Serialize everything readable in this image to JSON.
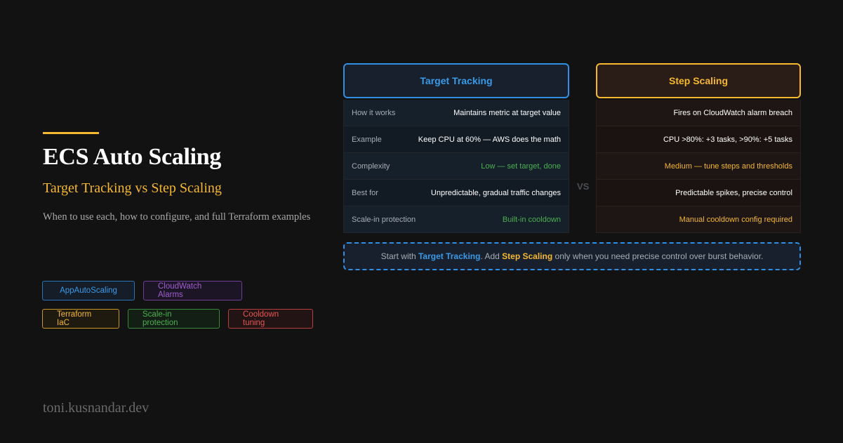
{
  "hero": {
    "title": "ECS Auto Scaling",
    "subtitle": "Target Tracking vs Step Scaling",
    "description": "When to use each, how to configure, and full Terraform examples"
  },
  "tags": [
    {
      "label": "AppAutoScaling",
      "color": "#3b9ae8"
    },
    {
      "label": "CloudWatch Alarms",
      "color": "#a05ccf"
    },
    {
      "label": "Terraform IaC",
      "color": "#f5b82e"
    },
    {
      "label": "Scale-in protection",
      "color": "#4cb050"
    },
    {
      "label": "Cooldown tuning",
      "color": "#e85454"
    }
  ],
  "comparison": {
    "left": {
      "title": "Target Tracking",
      "rows": [
        {
          "label": "How it works",
          "value": "Maintains metric at target value"
        },
        {
          "label": "Example",
          "value": "Keep CPU at 60% — AWS does the math"
        },
        {
          "label": "Complexity",
          "value": "Low — set target, done"
        },
        {
          "label": "Best for",
          "value": "Unpredictable, gradual traffic changes"
        },
        {
          "label": "Scale-in protection",
          "value": "Built-in cooldown"
        }
      ]
    },
    "vs_label": "VS",
    "right": {
      "title": "Step Scaling",
      "rows": [
        {
          "value": "Fires on CloudWatch alarm breach"
        },
        {
          "value": "CPU >80%: +3 tasks, >90%: +5 tasks"
        },
        {
          "value": "Medium — tune steps and thresholds"
        },
        {
          "value": "Predictable spikes, precise control"
        },
        {
          "value": "Manual cooldown config required"
        }
      ]
    }
  },
  "note": {
    "prefix": "Start with ",
    "highlight1": "Target Tracking",
    "middle": ". Add ",
    "highlight2": "Step Scaling",
    "suffix": " only when you need precise control over burst behavior."
  },
  "footer": "toni.kusnandar.dev",
  "colors": {
    "background": "#121212",
    "accent_yellow": "#f5b82e",
    "accent_blue": "#3b9ae8"
  }
}
